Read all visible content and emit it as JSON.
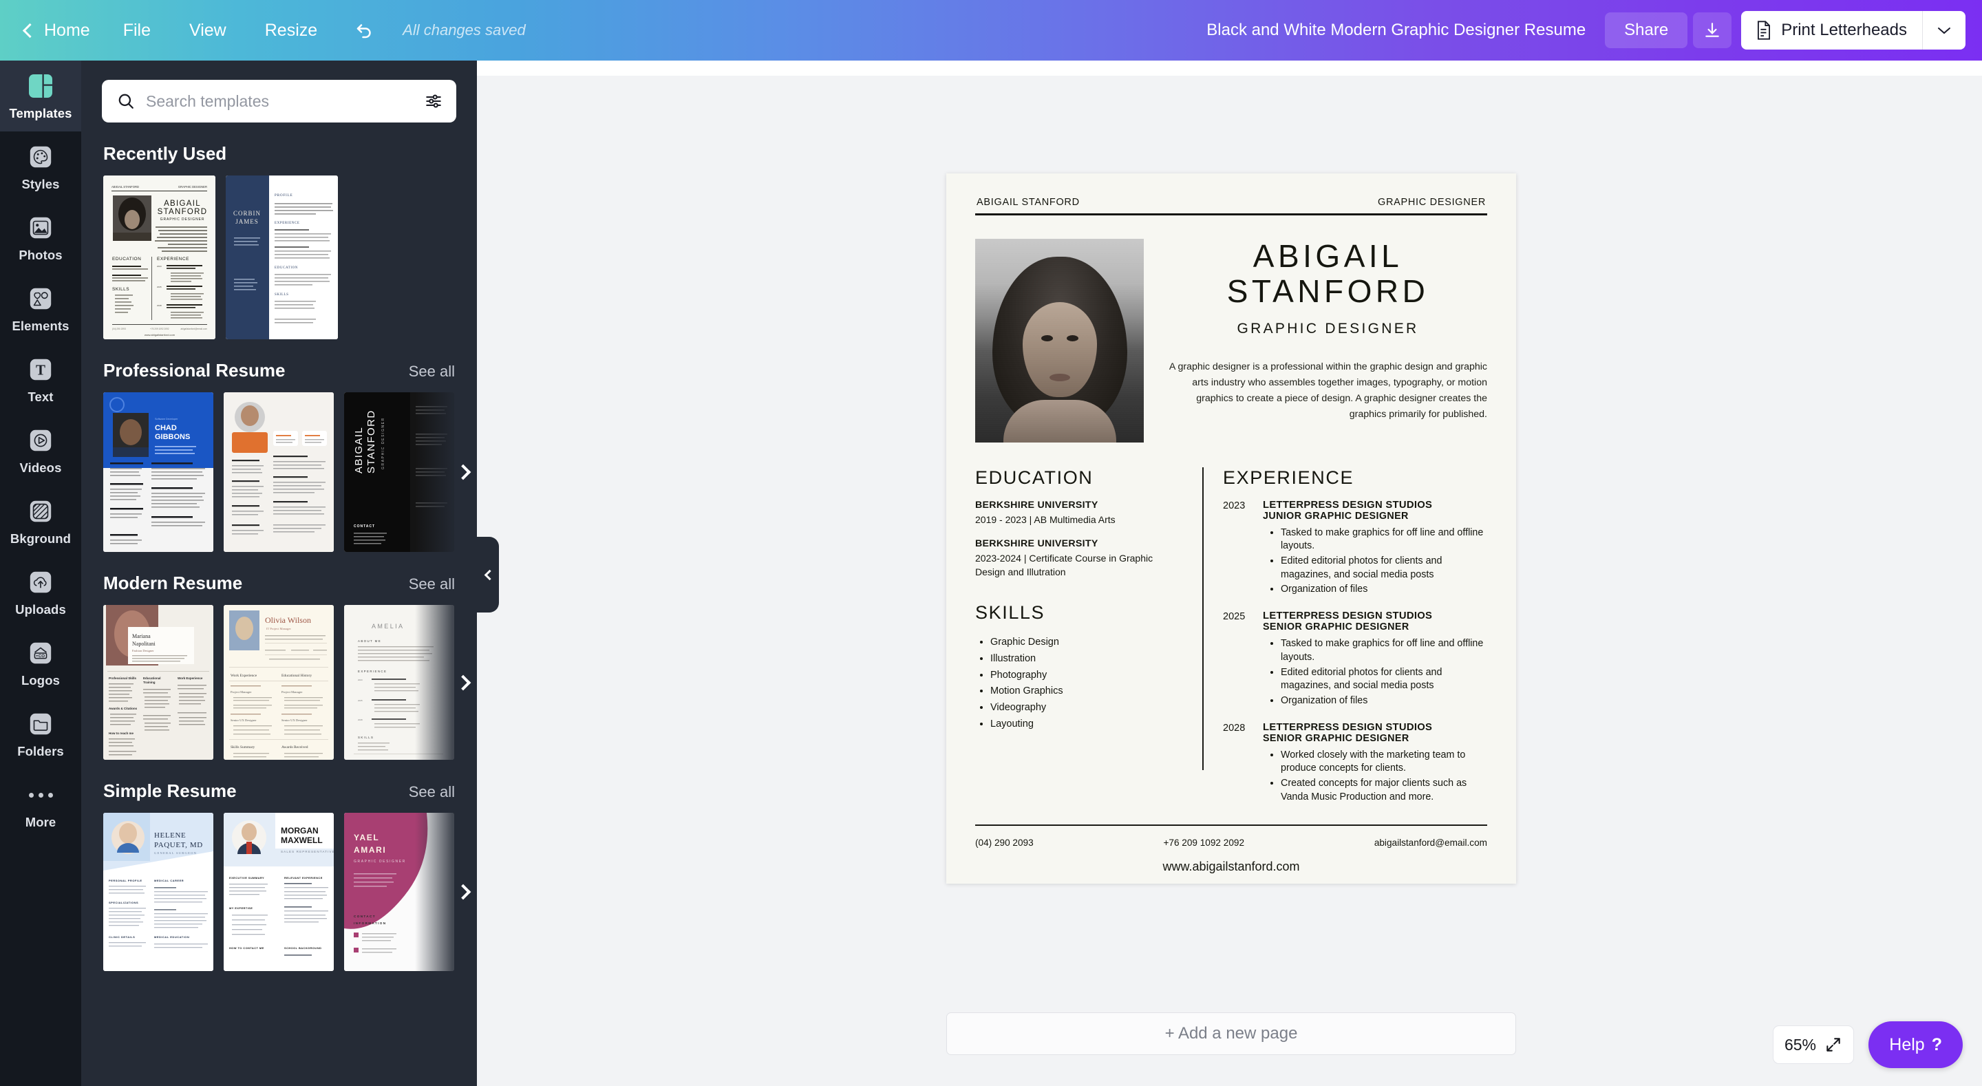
{
  "topbar": {
    "home_label": "Home",
    "menu": [
      "File",
      "View",
      "Resize"
    ],
    "undo_icon": "undo-icon",
    "save_status": "All changes saved",
    "doc_title": "Black and White Modern Graphic Designer Resume",
    "share_label": "Share",
    "download_icon": "download-icon",
    "print_label": "Print Letterheads",
    "print_icon": "document-icon",
    "caret_icon": "chevron-down-icon"
  },
  "rail": {
    "items": [
      {
        "label": "Templates",
        "icon": "templates-icon",
        "active": true
      },
      {
        "label": "Styles",
        "icon": "palette-icon",
        "active": false
      },
      {
        "label": "Photos",
        "icon": "image-icon",
        "active": false
      },
      {
        "label": "Elements",
        "icon": "shapes-icon",
        "active": false
      },
      {
        "label": "Text",
        "icon": "text-icon",
        "active": false
      },
      {
        "label": "Videos",
        "icon": "play-icon",
        "active": false
      },
      {
        "label": "Bkground",
        "icon": "hatch-icon",
        "active": false
      },
      {
        "label": "Uploads",
        "icon": "upload-cloud-icon",
        "active": false
      },
      {
        "label": "Logos",
        "icon": "logo-icon",
        "active": false
      },
      {
        "label": "Folders",
        "icon": "folder-icon",
        "active": false
      },
      {
        "label": "More",
        "icon": "ellipsis-icon",
        "active": false
      }
    ]
  },
  "search": {
    "placeholder": "Search templates",
    "value": "",
    "icon": "search-icon",
    "filter_icon": "filter-sliders-icon"
  },
  "panel": {
    "sections": [
      {
        "title": "Recently Used",
        "see_all": ""
      },
      {
        "title": "Professional Resume",
        "see_all": "See all"
      },
      {
        "title": "Modern Resume",
        "see_all": "See all"
      },
      {
        "title": "Simple Resume",
        "see_all": "See all"
      }
    ],
    "recent_thumbs": [
      "Abigail Stanford Resume",
      "Corbin James Resume"
    ],
    "pro_thumbs": [
      "Chad Gibbons",
      "Orange Profile Resume",
      "Abigail Stanford Dark"
    ],
    "modern_thumbs": [
      "Mariana Napolitani",
      "Olivia Wilson",
      "Amelia"
    ],
    "simple_thumbs": [
      "Helene Paquet, MD",
      "Morgan Maxwell",
      "Yael Amari"
    ],
    "collapse_icon": "chevron-left-icon",
    "next_icon": "chevron-right-icon"
  },
  "page_tools": {
    "notes_icon": "sticky-note-icon",
    "duplicate_icon": "duplicate-icon",
    "add_icon": "plus-icon"
  },
  "resume": {
    "header_left": "ABIGAIL STANFORD",
    "header_right": "GRAPHIC DESIGNER",
    "name_line1": "ABIGAIL",
    "name_line2": "STANFORD",
    "role": "GRAPHIC DESIGNER",
    "summary": "A graphic designer is a professional within the graphic design and graphic arts industry who assembles together images, typography, or motion graphics to create a piece of design. A graphic designer creates the graphics primarily for published.",
    "education_heading": "EDUCATION",
    "education": [
      {
        "org": "BERKSHIRE UNIVERSITY",
        "detail": "2019 - 2023 | AB Multimedia Arts"
      },
      {
        "org": "BERKSHIRE UNIVERSITY",
        "detail": "2023-2024 | Certificate Course in Graphic Design and Illutration"
      }
    ],
    "skills_heading": "SKILLS",
    "skills": [
      "Graphic Design",
      "Illustration",
      "Photography",
      "Motion Graphics",
      "Videography",
      "Layouting"
    ],
    "experience_heading": "EXPERIENCE",
    "experience": [
      {
        "year": "2023",
        "company": "LETTERPRESS DESIGN STUDIOS",
        "position": "JUNIOR GRAPHIC DESIGNER",
        "bullets": [
          "Tasked to make graphics for off line and offline layouts.",
          "Edited editorial photos for clients and magazines, and social media posts",
          "Organization of files"
        ]
      },
      {
        "year": "2025",
        "company": "LETTERPRESS DESIGN STUDIOS",
        "position": "SENIOR GRAPHIC DESIGNER",
        "bullets": [
          "Tasked to make graphics for off line and offline layouts.",
          "Edited editorial photos for clients and magazines, and social media posts",
          "Organization of files"
        ]
      },
      {
        "year": "2028",
        "company": "LETTERPRESS DESIGN STUDIOS",
        "position": "SENIOR GRAPHIC DESIGNER",
        "bullets": [
          "Worked closely with the marketing team to produce concepts for clients.",
          "Created concepts for major clients such as Vanda Music Production and more."
        ]
      }
    ],
    "contact_phone1": "(04) 290 2093",
    "contact_phone2": "+76 209 1092 2092",
    "contact_email": "abigailstanford@email.com",
    "website": "www.abigailstanford.com"
  },
  "footer": {
    "add_page_label": "+ Add a new page",
    "zoom_level": "65%",
    "expand_icon": "expand-arrows-icon",
    "help_label": "Help",
    "help_mark": "?"
  },
  "colors": {
    "accent_purple": "#7b2ff2",
    "rail_bg": "#14181f",
    "panel_bg": "#252b36",
    "canvas_bg": "#f2f3f5",
    "page_bg": "#f7f7f2",
    "templates_teal": "#6fd6c4"
  }
}
